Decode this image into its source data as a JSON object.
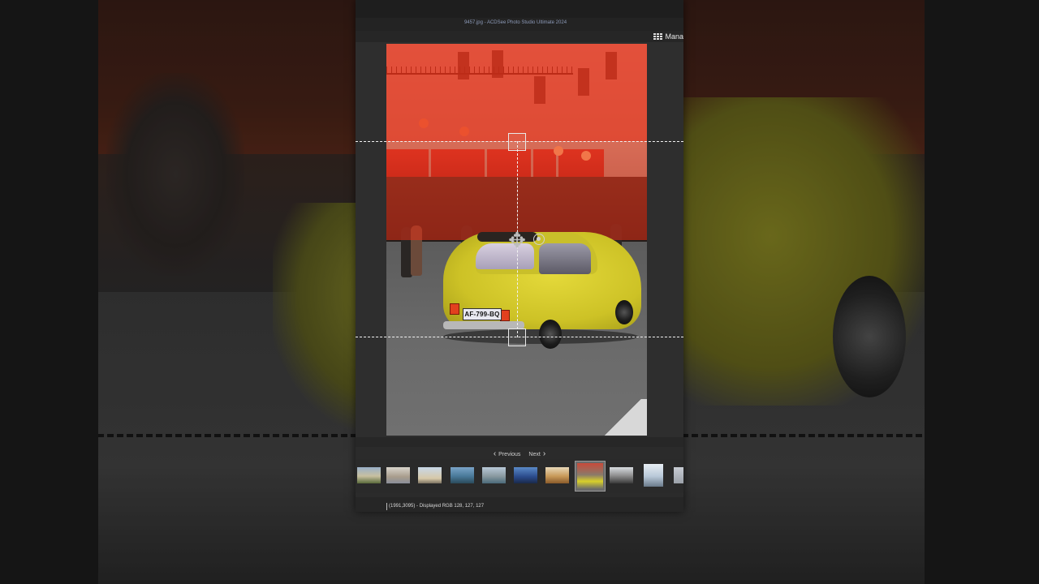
{
  "window": {
    "title": "9457.jpg - ACDSee Photo Studio Ultimate 2024"
  },
  "mode_tabs": {
    "manage_label": "Mana",
    "manage_icon": "grid-icon"
  },
  "photo": {
    "license_plate": "AF-799-BQ",
    "overlay_color": "#e62d14"
  },
  "navigation": {
    "previous_label": "Previous",
    "next_label": "Next"
  },
  "filmstrip": {
    "selected_index": 7
  },
  "status": {
    "text": "(1991,3095) - Displayed RGB 128, 127, 127"
  }
}
